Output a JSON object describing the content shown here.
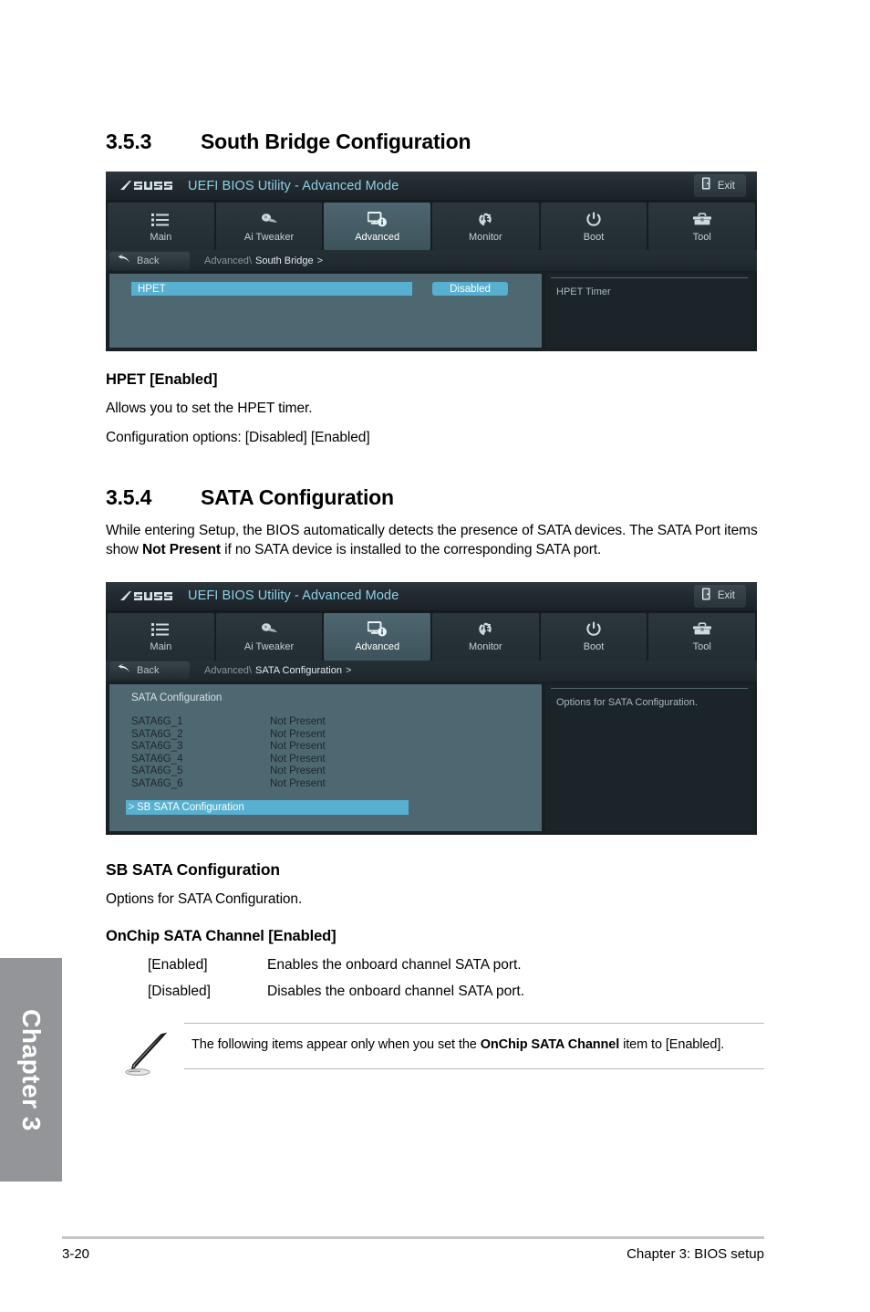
{
  "chapter_tab": {
    "label": "Chapter 3"
  },
  "footer": {
    "page_number": "3-20",
    "chapter_label": "Chapter 3: BIOS setup"
  },
  "section_353": {
    "number": "3.5.3",
    "title": "South Bridge Configuration"
  },
  "bios_screen_1": {
    "logo": "ASUS",
    "title": "UEFI BIOS Utility - Advanced Mode",
    "exit_label": "Exit",
    "exit_icon": "exit-door-icon",
    "tabs": [
      {
        "label": "Main",
        "icon": "list-icon",
        "active": false
      },
      {
        "label": "Ai  Tweaker",
        "icon": "fan-blade-icon",
        "active": false
      },
      {
        "label": "Advanced",
        "icon": "monitor-info-icon",
        "active": true
      },
      {
        "label": "Monitor",
        "icon": "thermometer-icon",
        "active": false
      },
      {
        "label": "Boot",
        "icon": "power-icon",
        "active": false
      },
      {
        "label": "Tool",
        "icon": "toolbox-icon",
        "active": false
      }
    ],
    "back_label": "Back",
    "back_icon": "back-arrow-icon",
    "breadcrumb_parent": "Advanced\\",
    "breadcrumb_current": "South Bridge",
    "breadcrumb_arrow": ">",
    "item_name": "HPET",
    "item_value": "Disabled",
    "help_text": "HPET  Timer"
  },
  "hpet_item": {
    "heading": "HPET [Enabled]",
    "description": "Allows you to set the HPET timer.",
    "options_line": "Configuration options: [Disabled] [Enabled]"
  },
  "section_354": {
    "number": "3.5.4",
    "title": "SATA Configuration",
    "intro_part1": "While entering Setup, the BIOS automatically detects the presence of SATA devices. The SATA Port items show ",
    "intro_bold": "Not Present",
    "intro_part2": " if no SATA device is installed to the corresponding SATA port."
  },
  "bios_screen_2": {
    "logo": "ASUS",
    "title": "UEFI BIOS Utility - Advanced Mode",
    "exit_label": "Exit",
    "exit_icon": "exit-door-icon",
    "tabs": [
      {
        "label": "Main",
        "icon": "list-icon",
        "active": false
      },
      {
        "label": "Ai  Tweaker",
        "icon": "fan-blade-icon",
        "active": false
      },
      {
        "label": "Advanced",
        "icon": "monitor-info-icon",
        "active": true
      },
      {
        "label": "Monitor",
        "icon": "thermometer-icon",
        "active": false
      },
      {
        "label": "Boot",
        "icon": "power-icon",
        "active": false
      },
      {
        "label": "Tool",
        "icon": "toolbox-icon",
        "active": false
      }
    ],
    "back_label": "Back",
    "back_icon": "back-arrow-icon",
    "breadcrumb_parent": "Advanced\\",
    "breadcrumb_current": "SATA Configuration",
    "breadcrumb_arrow": ">",
    "panel_heading": "SATA Configuration",
    "ports": [
      {
        "name": "SATA6G_1",
        "status": "Not Present"
      },
      {
        "name": "SATA6G_2",
        "status": "Not Present"
      },
      {
        "name": "SATA6G_3",
        "status": "Not Present"
      },
      {
        "name": "SATA6G_4",
        "status": "Not Present"
      },
      {
        "name": "SATA6G_5",
        "status": "Not Present"
      },
      {
        "name": "SATA6G_6",
        "status": "Not Present"
      }
    ],
    "submenu_arrow": ">",
    "submenu_label": "SB SATA Configuration",
    "help_text": "Options for SATA Configuration."
  },
  "sb_sata": {
    "heading": "SB SATA Configuration",
    "description": "Options for SATA Configuration.",
    "onchip_heading": "OnChip SATA Channel [Enabled]",
    "options": [
      {
        "key": "[Enabled]",
        "desc": "Enables the onboard channel SATA port."
      },
      {
        "key": "[Disabled]",
        "desc": "Disables the onboard channel SATA port."
      }
    ]
  },
  "note": {
    "icon": "pencil-note-icon",
    "text_part1": "The following items appear only when you set the ",
    "text_bold": "OnChip SATA Channel",
    "text_part2": " item to [Enabled]."
  },
  "colors": {
    "highlight_blue": "#57b0cf",
    "panel_slate": "#4d6871",
    "bios_dark": "#1b2529",
    "title_cyan": "#8fd0e6",
    "chapter_gray": "#939598"
  }
}
